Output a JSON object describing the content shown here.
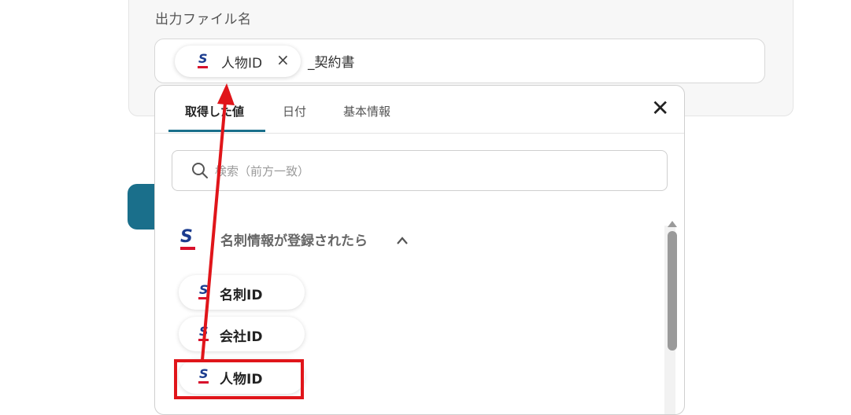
{
  "field": {
    "label": "出力ファイル名",
    "chip_label": "人物ID",
    "chip_close": "×",
    "suffix": "_契約書"
  },
  "dropdown": {
    "tabs": [
      {
        "label": "取得した値"
      },
      {
        "label": "日付"
      },
      {
        "label": "基本情報"
      }
    ],
    "close": "✕",
    "search_placeholder": "検索（前方一致）",
    "section_title": "名刺情報が登録されたら",
    "items": [
      {
        "label": "名刺ID"
      },
      {
        "label": "会社ID"
      },
      {
        "label": "人物ID"
      }
    ]
  },
  "colors": {
    "accent": "#1a6f8b",
    "logo_blue": "#1b3c8f",
    "logo_red": "#d8112c",
    "highlight": "#e0151a"
  },
  "icons": [
    "sansan-logo-icon",
    "close-icon",
    "search-icon",
    "chevron-up-icon",
    "scroll-up-arrow-icon"
  ]
}
